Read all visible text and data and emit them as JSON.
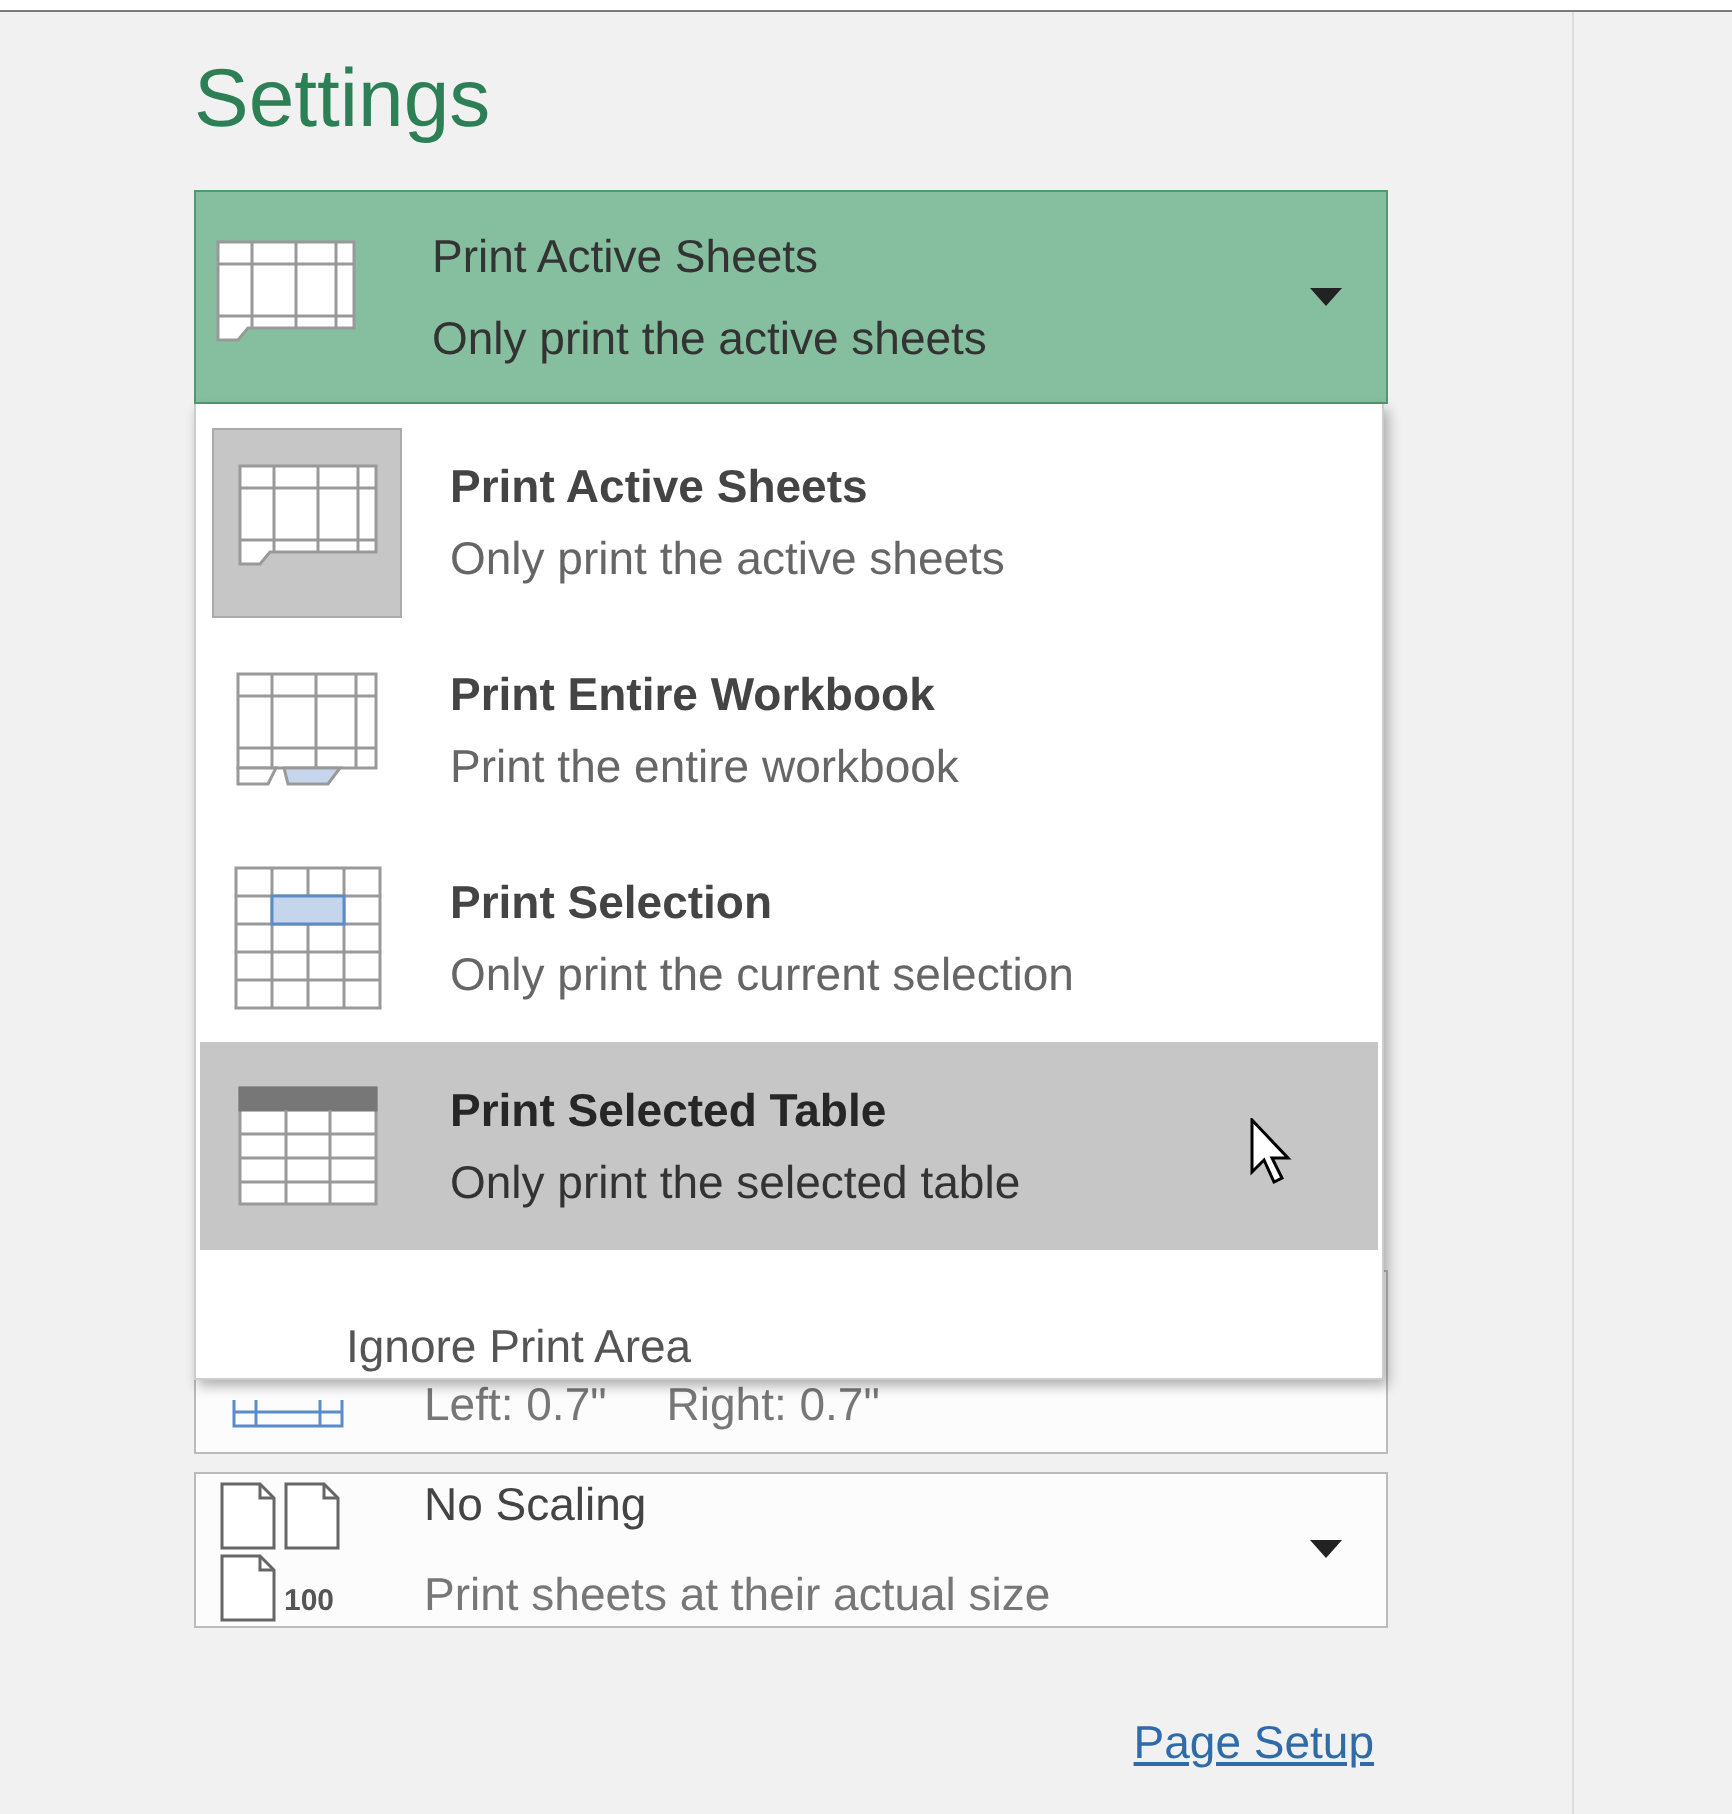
{
  "heading": "Settings",
  "print_what": {
    "title": "Print Active Sheets",
    "subtitle": "Only print the active sheets",
    "open": true
  },
  "menu": {
    "items": [
      {
        "kind": "sheet",
        "title": "Print Active Sheets",
        "subtitle": "Only print the active sheets",
        "selected": true,
        "hovered": false
      },
      {
        "kind": "workbook",
        "title": "Print Entire Workbook",
        "subtitle": "Print the entire workbook",
        "selected": false,
        "hovered": false
      },
      {
        "kind": "selection",
        "title": "Print Selection",
        "subtitle": "Only print the current selection",
        "selected": false,
        "hovered": false
      },
      {
        "kind": "table",
        "title": "Print Selected Table",
        "subtitle": "Only print the selected table",
        "selected": false,
        "hovered": true
      }
    ],
    "footer": "Ignore Print Area"
  },
  "margins": {
    "left": "Left:  0.7\"",
    "right": "Right:  0.7\""
  },
  "scaling": {
    "title": "No Scaling",
    "subtitle": "Print sheets at their actual size",
    "badge": "100"
  },
  "page_setup_link": "Page Setup"
}
